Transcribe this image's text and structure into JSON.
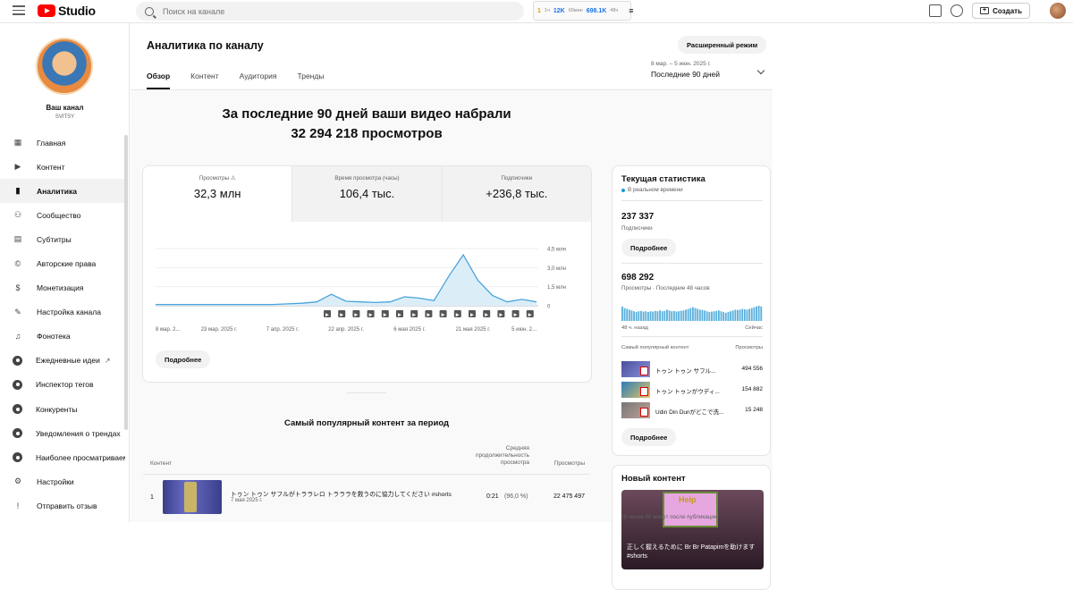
{
  "topbar": {
    "logo_text": "Studio",
    "search_placeholder": "Поиск на канале",
    "ext_a": "1",
    "ext_b": "12K",
    "ext_c": "698.1K",
    "ext_d": "1ч",
    "ext_e": "60мин",
    "ext_f": "48ч",
    "create_label": "Создать"
  },
  "sidebar": {
    "channel_label": "Ваш канал",
    "channel_handle": "SVITSY",
    "items": [
      {
        "label": "Главная",
        "icon": "dashboard-icon"
      },
      {
        "label": "Контент",
        "icon": "content-icon"
      },
      {
        "label": "Аналитика",
        "icon": "analytics-icon",
        "active": true
      },
      {
        "label": "Сообщество",
        "icon": "community-icon"
      },
      {
        "label": "Субтитры",
        "icon": "subtitles-icon"
      },
      {
        "label": "Авторские права",
        "icon": "copyright-icon"
      },
      {
        "label": "Монетизация",
        "icon": "monetization-icon"
      },
      {
        "label": "Настройка канала",
        "icon": "customization-icon"
      },
      {
        "label": "Фонотека",
        "icon": "audio-library-icon"
      },
      {
        "label": "Ежедневные идеи",
        "icon": "ext-icon"
      },
      {
        "label": "Инспектор тегов",
        "icon": "ext-icon"
      },
      {
        "label": "Конкуренты",
        "icon": "ext-icon"
      },
      {
        "label": "Уведомления о трендах",
        "icon": "ext-icon"
      },
      {
        "label": "Наиболее просматриваемые",
        "icon": "ext-icon"
      },
      {
        "label": "Настройки",
        "icon": "settings-icon"
      },
      {
        "label": "Отправить отзыв",
        "icon": "feedback-icon"
      }
    ]
  },
  "header": {
    "title": "Аналитика по каналу",
    "advanced_mode": "Расширенный режим",
    "tabs": [
      "Обзор",
      "Контент",
      "Аудитория",
      "Тренды"
    ],
    "date_sub": "8 мар. – 5 июн. 2025 г.",
    "date_main": "Последние 90 дней"
  },
  "overview": {
    "headline_1": "За последние 90 дней ваши видео набрали",
    "headline_2": "32 294 218 просмотров",
    "metrics": [
      {
        "label": "Просмотры ⚠",
        "value": "32,3 млн"
      },
      {
        "label": "Время просмотра (часы)",
        "value": "106,4 тыс."
      },
      {
        "label": "Подписчики",
        "value": "+236,8 тыс."
      }
    ],
    "more_label": "Подробнее"
  },
  "chart_data": {
    "type": "area",
    "x": [
      "8 мар.",
      "12 мар.",
      "16 мар.",
      "20 мар.",
      "24 мар.",
      "28 мар.",
      "1 апр.",
      "5 апр.",
      "9 апр.",
      "13 апр.",
      "17 апр.",
      "21 апр.",
      "25 апр.",
      "29 апр.",
      "3 мая",
      "7 мая",
      "9 мая",
      "11 мая",
      "13 мая",
      "15 мая",
      "17 мая",
      "19 мая",
      "21 мая",
      "25 мая",
      "29 мая",
      "2 июн.",
      "5 июн."
    ],
    "values": [
      0.1,
      0.1,
      0.1,
      0.1,
      0.1,
      0.1,
      0.1,
      0.1,
      0.1,
      0.15,
      0.2,
      0.3,
      0.9,
      0.35,
      0.3,
      0.25,
      0.3,
      0.7,
      0.6,
      0.4,
      2.3,
      4.0,
      2.0,
      0.8,
      0.3,
      0.5,
      0.3
    ],
    "xticks": [
      "8 мар. 2...",
      "23 мар. 2025 г.",
      "7 апр. 2025 г.",
      "22 апр. 2025 г.",
      "6 мая 2025 г.",
      "21 мая 2025 г.",
      "5 июн. 2..."
    ],
    "yticks": [
      "4,5 млн",
      "3,0 млн",
      "1,5 млн",
      "0"
    ],
    "ylim": [
      0,
      4.5
    ],
    "marker_count": 15,
    "marker_glyph": "▶"
  },
  "top_content": {
    "title": "Самый популярный контент за период",
    "col_content": "Контент",
    "col_duration": "Средняя продолжительность просмотра",
    "col_views": "Просмотры",
    "rows": [
      {
        "rank": "1",
        "title": "トゥン トゥン サフルがトララレロ トラララを救うのに協力してください #shorts",
        "date": "7 мая 2025 г.",
        "duration": "0:21",
        "percent": "(96,0 %)",
        "views": "22 475 497"
      }
    ]
  },
  "realtime": {
    "title": "Текущая статистика",
    "live": "В реальном времени",
    "subs_value": "237 337",
    "subs_label": "Подписчики",
    "more_label": "Подробнее",
    "views_value": "698 292",
    "views_label": "Просмотры · Последние 48 часов",
    "axis_left": "48 ч. назад",
    "axis_right": "Сейчас",
    "top_label": "Самый популярный контент",
    "top_views_label": "Просмотры",
    "items": [
      {
        "name": "トゥン トゥン サフル...",
        "views": "494 556"
      },
      {
        "name": "トゥン トゥンがウディ...",
        "views": "154 882"
      },
      {
        "name": "Udin Din Dunがどこで洗...",
        "views": "15 248"
      }
    ],
    "bars": [
      0.9,
      0.8,
      0.75,
      0.7,
      0.65,
      0.6,
      0.55,
      0.6,
      0.62,
      0.58,
      0.6,
      0.55,
      0.6,
      0.58,
      0.62,
      0.6,
      0.65,
      0.6,
      0.62,
      0.7,
      0.65,
      0.6,
      0.62,
      0.58,
      0.6,
      0.63,
      0.65,
      0.7,
      0.75,
      0.8,
      0.85,
      0.8,
      0.75,
      0.7,
      0.68,
      0.65,
      0.6,
      0.55,
      0.58,
      0.6,
      0.62,
      0.65,
      0.6,
      0.55,
      0.5,
      0.55,
      0.6,
      0.65,
      0.7,
      0.68,
      0.7,
      0.75,
      0.72,
      0.7,
      0.75,
      0.8,
      0.85,
      0.9,
      0.95,
      0.9
    ]
  },
  "new_content": {
    "title": "Новый контент",
    "thumb_word": "Help",
    "caption": "正しく握えるために Br Br Patapimを助けます #shorts",
    "time": "18 часов 46 минут после публикации"
  }
}
